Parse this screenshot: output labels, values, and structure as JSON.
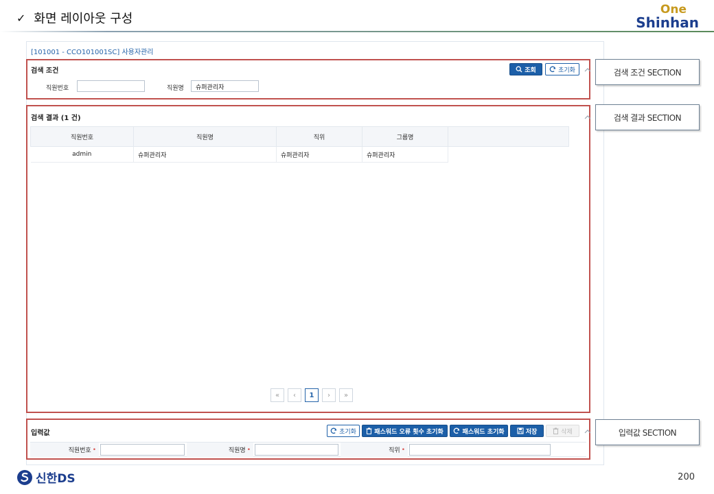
{
  "slide": {
    "check_mark": "✓",
    "title": "화면 레이아웃 구성",
    "page_number": "200"
  },
  "logo": {
    "top": "One",
    "bottom": "Shinhan"
  },
  "footer_logo": {
    "text": "신한DS"
  },
  "app": {
    "title": "[101001 - CCO101001SC] 사용자관리"
  },
  "search_section": {
    "title": "검색 조건",
    "search_button": "조회",
    "reset_button": "초기화",
    "fields": [
      {
        "label": "직원번호",
        "value": ""
      },
      {
        "label": "직원명",
        "value": "슈퍼관리자"
      }
    ]
  },
  "result_section": {
    "title": "검색 결과  (1 건)",
    "columns": [
      "직원번호",
      "직원명",
      "직위",
      "그룹명"
    ],
    "rows": [
      [
        "admin",
        "슈퍼관리자",
        "슈퍼관리자",
        "슈퍼관리자"
      ]
    ],
    "pagination": {
      "first": "«",
      "prev": "‹",
      "current": "1",
      "next": "›",
      "last": "»"
    }
  },
  "input_section": {
    "title": "입력값",
    "buttons": {
      "reset": "초기화",
      "pw_error_reset": "패스워드 오류 횟수 초기화",
      "pw_reset": "패스워드 초기화",
      "save": "저장",
      "delete": "삭제"
    },
    "fields": [
      {
        "label": "직원번호",
        "required": "•",
        "value": ""
      },
      {
        "label": "직원명",
        "required": "•",
        "value": ""
      },
      {
        "label": "직위",
        "required": "•",
        "value": ""
      }
    ]
  },
  "callouts": {
    "search": "검색 조건 SECTION",
    "result": "검색 결과 SECTION",
    "input": "입력값 SECTION"
  },
  "colors": {
    "primary": "#1c5fa8",
    "highlight": "#c0504d",
    "title_blue": "#2463a9",
    "logo_gold": "#c79a1f",
    "logo_navy": "#1c3e8e"
  }
}
